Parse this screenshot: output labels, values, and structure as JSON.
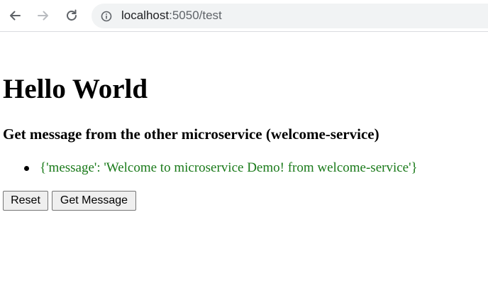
{
  "browser": {
    "url_host": "localhost",
    "url_path": ":5050/test",
    "icons": {
      "back": "arrow-left",
      "forward": "arrow-right",
      "reload": "circular-arrow",
      "info": "info-circle"
    }
  },
  "page": {
    "title": "Hello World",
    "subheading": "Get message from the other microservice (welcome-service)",
    "messages": [
      "{'message': 'Welcome to microservice Demo! from welcome-service'}"
    ],
    "message_color": "#1a7a1a",
    "buttons": {
      "reset_label": "Reset",
      "get_message_label": "Get Message"
    }
  }
}
